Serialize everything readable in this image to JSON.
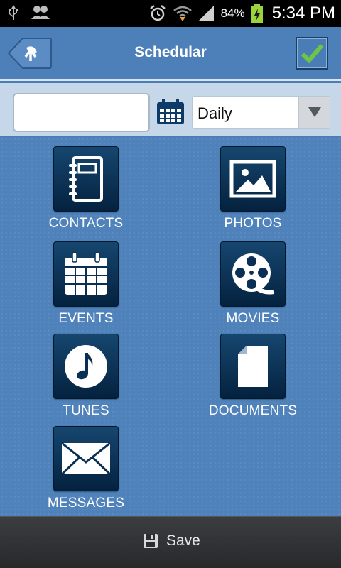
{
  "status_bar": {
    "battery_percent": "84%",
    "time": "5:34 PM",
    "icons": [
      "usb-icon",
      "contacts-sync-icon",
      "alarm-icon",
      "wifi-icon",
      "signal-icon",
      "battery-charging-icon"
    ]
  },
  "header": {
    "title": "Schedular",
    "back_icon": "back-arrow-icon",
    "confirm_icon": "checkmark-icon"
  },
  "filter": {
    "input_value": "",
    "calendar_icon": "calendar-icon",
    "frequency_selected": "Daily"
  },
  "tiles": [
    {
      "label": "CONTACTS",
      "icon": "contacts-book-icon"
    },
    {
      "label": "PHOTOS",
      "icon": "photo-icon"
    },
    {
      "label": "EVENTS",
      "icon": "events-calendar-icon"
    },
    {
      "label": "MOVIES",
      "icon": "film-reel-icon"
    },
    {
      "label": "TUNES",
      "icon": "music-note-icon"
    },
    {
      "label": "DOCUMENTS",
      "icon": "document-icon"
    },
    {
      "label": "MESSAGES",
      "icon": "envelope-icon"
    }
  ],
  "bottom_bar": {
    "save_label": "Save",
    "save_icon": "floppy-disk-icon"
  },
  "colors": {
    "background": "#4a7db5",
    "header": "#4d80b8",
    "tile_dark": "#04223f",
    "confirm_check": "#6cc644"
  }
}
